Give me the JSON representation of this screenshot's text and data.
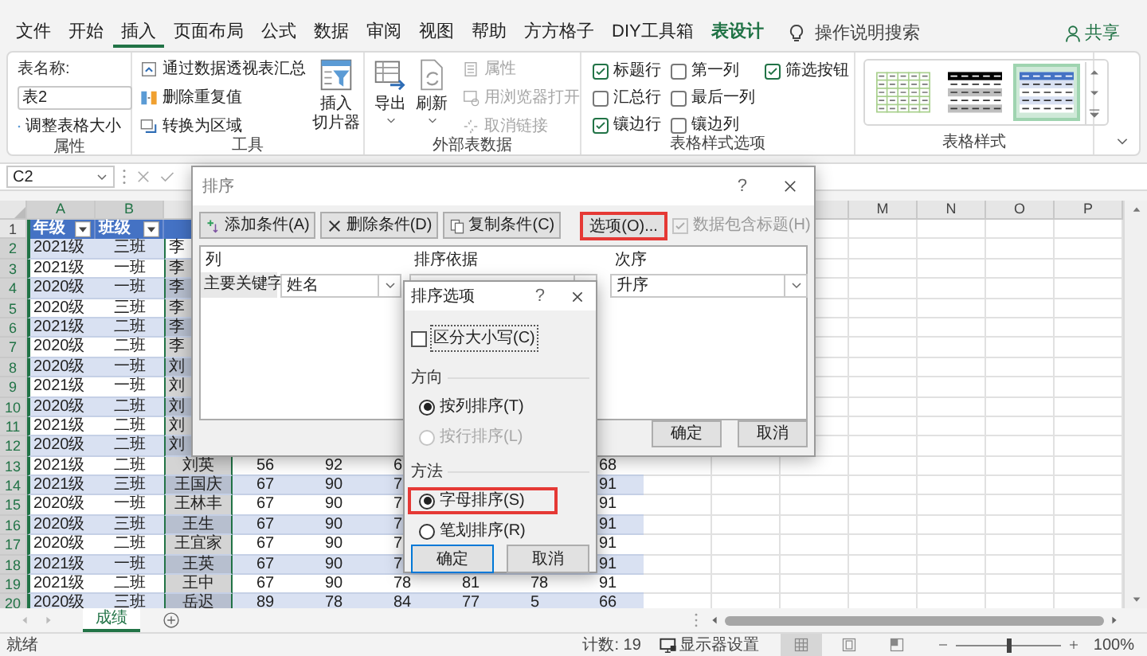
{
  "ribbon_tabs": [
    {
      "label": "文件",
      "selected": false,
      "kind": "tab"
    },
    {
      "label": "开始",
      "selected": false,
      "kind": "tab"
    },
    {
      "label": "插入",
      "selected": true,
      "kind": "tab"
    },
    {
      "label": "页面布局",
      "selected": false,
      "kind": "tab"
    },
    {
      "label": "公式",
      "selected": false,
      "kind": "tab"
    },
    {
      "label": "数据",
      "selected": false,
      "kind": "tab"
    },
    {
      "label": "审阅",
      "selected": false,
      "kind": "tab"
    },
    {
      "label": "视图",
      "selected": false,
      "kind": "tab"
    },
    {
      "label": "帮助",
      "selected": false,
      "kind": "tab"
    },
    {
      "label": "方方格子",
      "selected": false,
      "kind": "tab"
    },
    {
      "label": "DIY工具箱",
      "selected": false,
      "kind": "tab"
    },
    {
      "label": "表设计",
      "selected": false,
      "kind": "contextual"
    }
  ],
  "tell_me": "操作说明搜索",
  "share": "共享",
  "ribbon": {
    "properties": {
      "name_label": "表名称:",
      "table_name": "表2",
      "resize": "调整表格大小",
      "caption": "属性"
    },
    "tools": {
      "items": [
        "通过数据透视表汇总",
        "删除重复值",
        "转换为区域"
      ],
      "slicer": [
        "插入",
        "切片器"
      ],
      "caption": "工具"
    },
    "external": {
      "export": "导出",
      "refresh": "刷新",
      "items": [
        {
          "label": "属性",
          "disabled": true
        },
        {
          "label": "用浏览器打开",
          "disabled": true
        },
        {
          "label": "取消链接",
          "disabled": true
        }
      ],
      "caption": "外部表数据"
    },
    "style_options": {
      "items": [
        {
          "label": "标题行",
          "checked": true
        },
        {
          "label": "汇总行",
          "checked": false
        },
        {
          "label": "镶边行",
          "checked": true
        },
        {
          "label": "第一列",
          "checked": false
        },
        {
          "label": "最后一列",
          "checked": false
        },
        {
          "label": "镶边列",
          "checked": false
        },
        {
          "label": "筛选按钮",
          "checked": true
        }
      ],
      "caption": "表格样式选项"
    },
    "styles": {
      "swatches": [
        {
          "kind": "light",
          "selected": false
        },
        {
          "kind": "dark",
          "selected": false
        },
        {
          "kind": "medium",
          "selected": true
        }
      ],
      "caption": "表格样式"
    }
  },
  "name_box": "C2",
  "sheet": {
    "column_headers": {
      "left": [
        "A",
        "B"
      ],
      "right": [
        "M",
        "N",
        "O",
        "P"
      ]
    },
    "header_row": {
      "num": "1",
      "cells": [
        "年级",
        "班级"
      ]
    },
    "rows": [
      {
        "num": "2",
        "cells": [
          "2021级",
          "三班",
          "李"
        ]
      },
      {
        "num": "3",
        "cells": [
          "2021级",
          "一班",
          "李"
        ]
      },
      {
        "num": "4",
        "cells": [
          "2020级",
          "一班",
          "李"
        ]
      },
      {
        "num": "5",
        "cells": [
          "2020级",
          "三班",
          "李"
        ]
      },
      {
        "num": "6",
        "cells": [
          "2021级",
          "二班",
          "李"
        ]
      },
      {
        "num": "7",
        "cells": [
          "2020级",
          "二班",
          "李"
        ]
      },
      {
        "num": "8",
        "cells": [
          "2020级",
          "一班",
          "刘"
        ]
      },
      {
        "num": "9",
        "cells": [
          "2021级",
          "一班",
          "刘"
        ]
      },
      {
        "num": "10",
        "cells": [
          "2020级",
          "二班",
          "刘"
        ]
      },
      {
        "num": "11",
        "cells": [
          "2021级",
          "二班",
          "刘"
        ]
      },
      {
        "num": "12",
        "cells": [
          "2020级",
          "二班",
          "刘"
        ]
      },
      {
        "num": "13",
        "cells": [
          "2021级",
          "二班",
          "刘英",
          "56",
          "92",
          "6",
          null,
          null,
          "68"
        ]
      },
      {
        "num": "14",
        "cells": [
          "2021级",
          "三班",
          "王国庆",
          "67",
          "90",
          "7",
          null,
          null,
          "91"
        ]
      },
      {
        "num": "15",
        "cells": [
          "2020级",
          "一班",
          "王林丰",
          "67",
          "90",
          "7",
          null,
          null,
          "91"
        ]
      },
      {
        "num": "16",
        "cells": [
          "2020级",
          "三班",
          "王生",
          "67",
          "90",
          "7",
          null,
          null,
          "91"
        ]
      },
      {
        "num": "17",
        "cells": [
          "2020级",
          "二班",
          "王宜家",
          "67",
          "90",
          "7",
          null,
          null,
          "91"
        ]
      },
      {
        "num": "18",
        "cells": [
          "2021级",
          "一班",
          "王英",
          "67",
          "90",
          "7",
          null,
          null,
          "91"
        ]
      },
      {
        "num": "19",
        "cells": [
          "2021级",
          "二班",
          "王中",
          "67",
          "90",
          "78",
          "81",
          "78",
          "91"
        ]
      },
      {
        "num": "20",
        "cells": [
          "2020级",
          "三班",
          "岳迟",
          "89",
          "78",
          "84",
          "77",
          "5",
          "66"
        ]
      }
    ]
  },
  "sort_dialog": {
    "title": "排序",
    "help": "?",
    "toolbar": [
      {
        "label": "添加条件(A)",
        "kind": "add"
      },
      {
        "label": "删除条件(D)",
        "kind": "delete"
      },
      {
        "label": "复制条件(C)",
        "kind": "copy"
      }
    ],
    "options_button": {
      "label": "选项(O)...",
      "highlighted": true
    },
    "has_headers": {
      "label": "数据包含标题(H)",
      "checked": true,
      "disabled": true
    },
    "columns": [
      "列",
      "排序依据",
      "次序"
    ],
    "criteria": [
      {
        "label": "主要关键字",
        "column": "姓名",
        "order": "升序"
      }
    ],
    "buttons": [
      "确定",
      "取消"
    ]
  },
  "sort_options_dialog": {
    "title": "排序选项",
    "help": "?",
    "case_sensitive": {
      "label": "区分大小写(C)",
      "checked": false
    },
    "direction": {
      "heading": "方向",
      "options": [
        {
          "label": "按列排序(T)",
          "selected": true,
          "disabled": false,
          "highlighted": false
        },
        {
          "label": "按行排序(L)",
          "selected": false,
          "disabled": true,
          "highlighted": false
        }
      ]
    },
    "method": {
      "heading": "方法",
      "options": [
        {
          "label": "字母排序(S)",
          "selected": true,
          "disabled": false,
          "highlighted": true
        },
        {
          "label": "笔划排序(R)",
          "selected": false,
          "disabled": false,
          "highlighted": false
        }
      ]
    },
    "buttons": [
      "确定",
      "取消"
    ]
  },
  "sheet_tabs": [
    {
      "label": "成绩",
      "selected": true
    }
  ],
  "status_bar": {
    "ready": "就绪",
    "count": "计数: 19",
    "display_settings": "显示器设置",
    "views": [
      {
        "kind": "normal",
        "selected": true
      },
      {
        "kind": "page-layout",
        "selected": false
      },
      {
        "kind": "page-break",
        "selected": false
      }
    ],
    "zoom": {
      "level": 0.5,
      "reading": "100%"
    }
  }
}
